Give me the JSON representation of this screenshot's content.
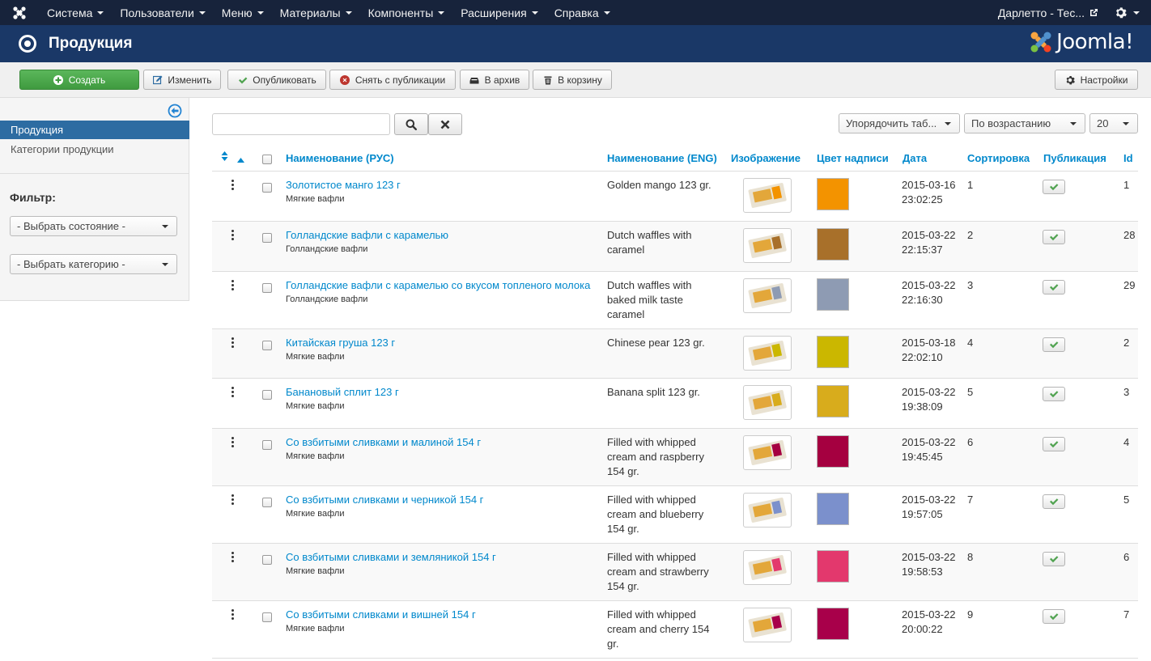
{
  "nav": {
    "menu": [
      "Система",
      "Пользователи",
      "Меню",
      "Материалы",
      "Компоненты",
      "Расширения",
      "Справка"
    ],
    "site_name": "Дарлетто - Тес..."
  },
  "header": {
    "title": "Продукция",
    "brand": "Joomla!"
  },
  "toolbar": {
    "new": "Создать",
    "edit": "Изменить",
    "publish": "Опубликовать",
    "unpublish": "Снять с публикации",
    "archive": "В архив",
    "trash": "В корзину",
    "options": "Настройки"
  },
  "sidebar": {
    "items": [
      "Продукция",
      "Категории продукции"
    ],
    "filter_label": "Фильтр:",
    "select_state": "- Выбрать состояние -",
    "select_category": "- Выбрать категорию -"
  },
  "list_controls": {
    "order_by": "Упорядочить таб...",
    "direction": "По возрастанию",
    "limit": "20"
  },
  "table": {
    "columns": {
      "name_ru": "Наименование (РУС)",
      "name_en": "Наименование (ENG)",
      "image": "Изображение",
      "color": "Цвет надписи",
      "date": "Дата",
      "ordering": "Сортировка",
      "published": "Публикация",
      "id": "Id"
    },
    "rows": [
      {
        "name_ru": "Золотистое манго 123 г",
        "category": "Мягкие вафли",
        "name_en": [
          "Golden mango 123 gr."
        ],
        "color": "#f39300",
        "date": "2015-03-16",
        "time": "23:02:25",
        "ordering": "1",
        "id": "1"
      },
      {
        "name_ru": "Голландские вафли с карамелью",
        "category": "Голландские вафли",
        "name_en": [
          "Dutch waffles with",
          "caramel"
        ],
        "color": "#a8702a",
        "date": "2015-03-22",
        "time": "22:15:37",
        "ordering": "2",
        "id": "28"
      },
      {
        "name_ru": "Голландские вафли с карамелью со вкусом топленого молока",
        "category": "Голландские вафли",
        "name_en": [
          "Dutch waffles with",
          "baked milk taste",
          "caramel"
        ],
        "color": "#8e9bb3",
        "date": "2015-03-22",
        "time": "22:16:30",
        "ordering": "3",
        "id": "29"
      },
      {
        "name_ru": "Китайская груша 123 г",
        "category": "Мягкие вафли",
        "name_en": [
          "Chinese pear 123 gr."
        ],
        "color": "#cbb700",
        "date": "2015-03-18",
        "time": "22:02:10",
        "ordering": "4",
        "id": "2"
      },
      {
        "name_ru": "Банановый сплит 123 г",
        "category": "Мягкие вафли",
        "name_en": [
          "Banana split 123 gr."
        ],
        "color": "#d8ac1c",
        "date": "2015-03-22",
        "time": "19:38:09",
        "ordering": "5",
        "id": "3"
      },
      {
        "name_ru": "Со взбитыми сливками и малиной 154 г",
        "category": "Мягкие вафли",
        "name_en": [
          "Filled with whipped",
          "cream and raspberry",
          "154 gr."
        ],
        "color": "#a50040",
        "date": "2015-03-22",
        "time": "19:45:45",
        "ordering": "6",
        "id": "4"
      },
      {
        "name_ru": "Со взбитыми сливками и черникой 154 г",
        "category": "Мягкие вафли",
        "name_en": [
          "Filled with whipped",
          "cream and blueberry",
          "154 gr."
        ],
        "color": "#7b90cc",
        "date": "2015-03-22",
        "time": "19:57:05",
        "ordering": "7",
        "id": "5"
      },
      {
        "name_ru": "Со взбитыми сливками и земляникой 154 г",
        "category": "Мягкие вафли",
        "name_en": [
          "Filled with whipped",
          "cream and strawberry",
          "154 gr."
        ],
        "color": "#e3386d",
        "date": "2015-03-22",
        "time": "19:58:53",
        "ordering": "8",
        "id": "6"
      },
      {
        "name_ru": "Со взбитыми сливками и вишней 154 г",
        "category": "Мягкие вафли",
        "name_en": [
          "Filled with whipped",
          "cream and cherry 154",
          "gr."
        ],
        "color": "#a8004a",
        "date": "2015-03-22",
        "time": "20:00:22",
        "ordering": "9",
        "id": "7"
      }
    ]
  },
  "colors": {
    "navbar": "#17233b",
    "header": "#1a3867",
    "link": "#0088cc",
    "success": "#5bb75b"
  }
}
